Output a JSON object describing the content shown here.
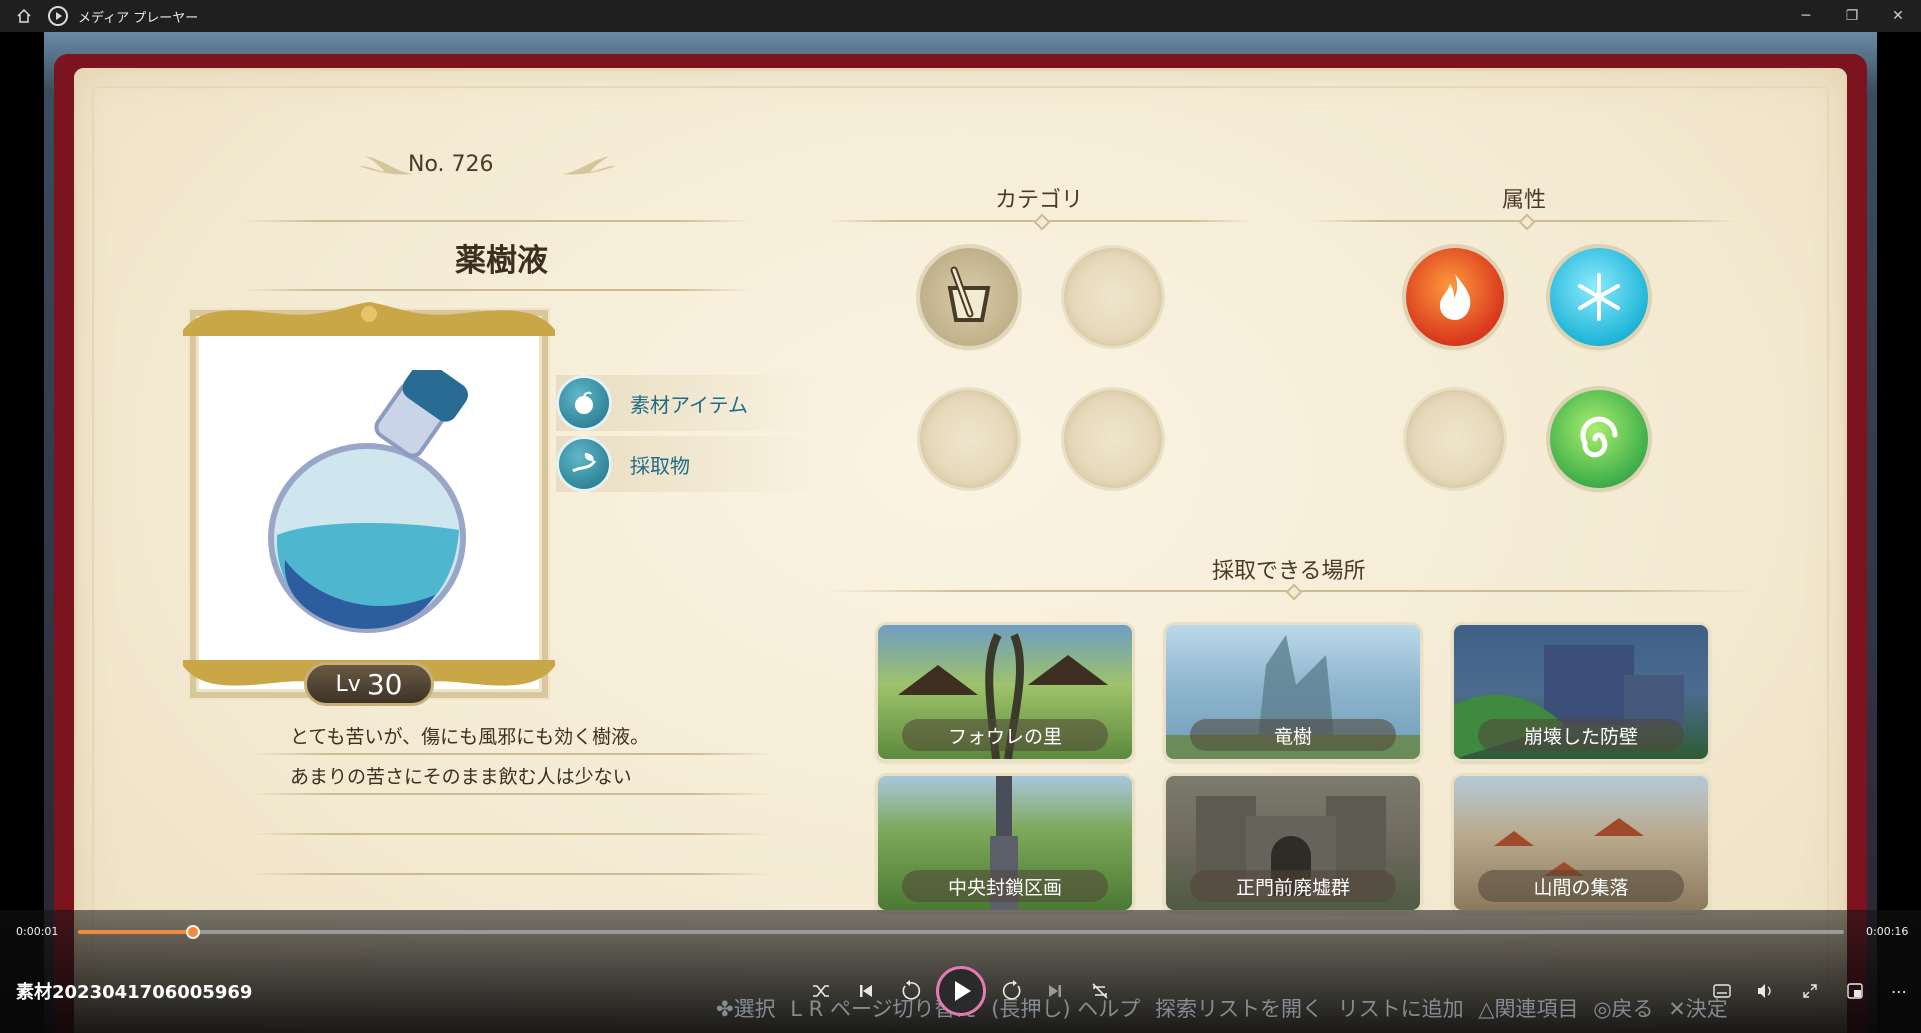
{
  "window": {
    "title": "メディア プレーヤー",
    "controls": {
      "minimize": "─",
      "restore": "❐",
      "close": "✕"
    }
  },
  "game": {
    "item": {
      "number_label": "No. 726",
      "name": "薬樹液",
      "level_prefix": "Lv",
      "level": "30",
      "tags": [
        {
          "label": "素材アイテム",
          "icon": "apple-icon"
        },
        {
          "label": "採取物",
          "icon": "hand-leaf-icon"
        }
      ],
      "description": [
        "とても苦いが、傷にも風邪にも効く樹液。",
        "あまりの苦さにそのまま飲む人は少ない"
      ]
    },
    "category": {
      "title": "カテゴリ",
      "slots": [
        {
          "icon": "mortar-pestle-icon",
          "filled": true
        },
        {
          "filled": false
        },
        {
          "filled": false
        },
        {
          "filled": false
        }
      ]
    },
    "attribute": {
      "title": "属性",
      "slots": [
        {
          "icon": "fire-icon",
          "color": "#e8542a"
        },
        {
          "icon": "ice-icon",
          "color": "#27b9d6"
        },
        {
          "filled": false
        },
        {
          "icon": "wind-icon",
          "color": "#3fae4a"
        }
      ]
    },
    "locations": {
      "title": "採取できる場所",
      "items": [
        {
          "name": "フォウレの里",
          "color": "#5b8a3c"
        },
        {
          "name": "竜樹",
          "color": "#6f9bb8"
        },
        {
          "name": "崩壊した防壁",
          "color": "#4b6c8f"
        },
        {
          "name": "中央封鎖区画",
          "color": "#6d9546"
        },
        {
          "name": "正門前廃墟群",
          "color": "#6e6a5e"
        },
        {
          "name": "山間の集落",
          "color": "#a89678"
        }
      ]
    }
  },
  "player": {
    "current_time": "0:00:01",
    "total_time": "0:00:16",
    "progress": 0.065,
    "file_title": "素材2023041706005969",
    "accent": "#f08a3e",
    "hints": [
      "✤選択",
      "L R ページ切り替え",
      "(長押し) ヘルプ",
      "探索リストを開く",
      "リストに追加",
      "△関連項目",
      "◎戻る",
      "✕決定"
    ]
  }
}
